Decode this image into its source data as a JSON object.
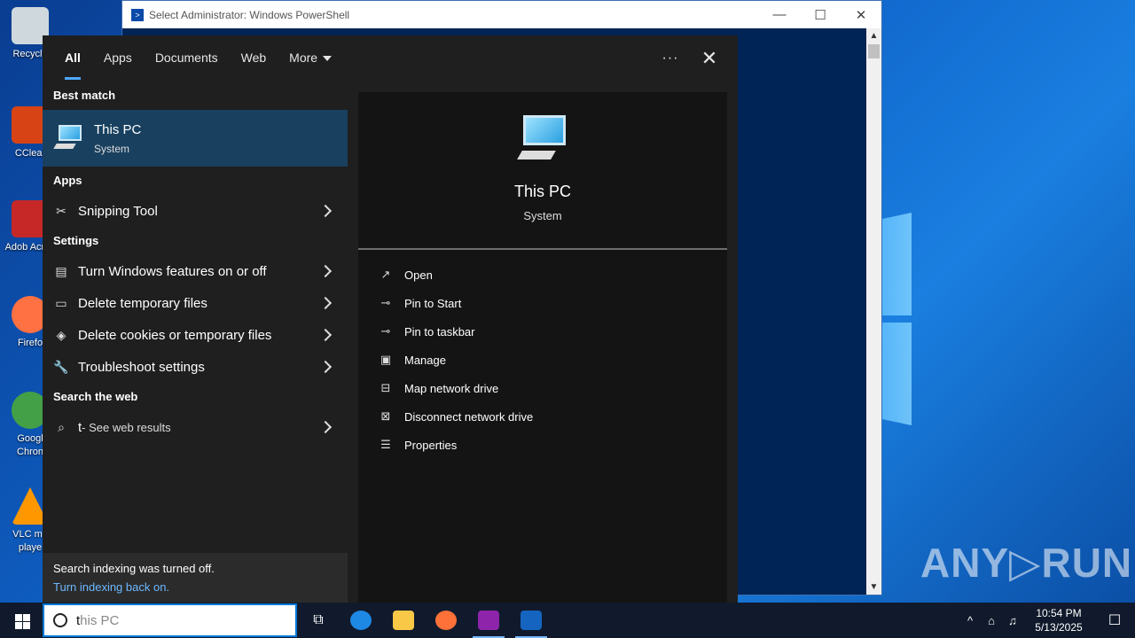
{
  "desktop": {
    "icons": [
      {
        "label": "Recycle",
        "color": "#cfd8dc"
      },
      {
        "label": "CClear",
        "color": "#d84315"
      },
      {
        "label": "Adob Acrob",
        "color": "#c62828"
      },
      {
        "label": "Firefo",
        "color": "#ff7043"
      },
      {
        "label": "Googl Chron",
        "color": "#43a047"
      },
      {
        "label": "VLC me playe",
        "color": "#ff9800"
      }
    ],
    "watermark": "ANY▷RUN"
  },
  "powershell": {
    "title": "Select Administrator: Windows PowerShell",
    "minimize": "—",
    "maximize": "☐",
    "close": "✕"
  },
  "search_panel": {
    "tabs": [
      {
        "label": "All",
        "active": true
      },
      {
        "label": "Apps"
      },
      {
        "label": "Documents"
      },
      {
        "label": "Web"
      },
      {
        "label": "More"
      }
    ],
    "more_options": "···",
    "close": "✕",
    "best_match": {
      "heading": "Best match",
      "title": "This PC",
      "subtitle": "System"
    },
    "apps": {
      "heading": "Apps",
      "items": [
        {
          "label": "Snipping Tool",
          "icon": "scissors-icon"
        }
      ]
    },
    "settings": {
      "heading": "Settings",
      "items": [
        {
          "label": "Turn Windows features on or off",
          "icon": "windows-features-icon"
        },
        {
          "label": "Delete temporary files",
          "icon": "drive-icon"
        },
        {
          "label": "Delete cookies or temporary files",
          "icon": "internet-options-icon"
        },
        {
          "label": "Troubleshoot settings",
          "icon": "wrench-icon"
        }
      ]
    },
    "web": {
      "heading": "Search the web",
      "query": "t",
      "suffix": " - See web results"
    },
    "notice": {
      "text": "Search indexing was turned off.",
      "link": "Turn indexing back on."
    },
    "preview": {
      "title": "This PC",
      "subtitle": "System",
      "actions": [
        {
          "label": "Open",
          "icon": "open-icon"
        },
        {
          "label": "Pin to Start",
          "icon": "pin-icon"
        },
        {
          "label": "Pin to taskbar",
          "icon": "pin-icon"
        },
        {
          "label": "Manage",
          "icon": "manage-icon"
        },
        {
          "label": "Map network drive",
          "icon": "network-drive-icon"
        },
        {
          "label": "Disconnect network drive",
          "icon": "network-drive-icon"
        },
        {
          "label": "Properties",
          "icon": "properties-icon"
        }
      ]
    }
  },
  "taskbar": {
    "search_typed": "t",
    "search_suggestion": "his PC",
    "apps": [
      {
        "name": "task-view",
        "color": "#101a2c"
      },
      {
        "name": "edge",
        "color": "#1e88e5"
      },
      {
        "name": "file-explorer",
        "color": "#f9c846"
      },
      {
        "name": "firefox",
        "color": "#ff7139"
      },
      {
        "name": "winrar",
        "color": "#8e24aa"
      },
      {
        "name": "powershell",
        "color": "#1565c0"
      }
    ],
    "clock_time": "10:54 PM",
    "clock_date": "5/13/2025",
    "tray": {
      "chevron": "^",
      "network": "⌂",
      "volume": "♫",
      "notifications": "☐"
    }
  }
}
